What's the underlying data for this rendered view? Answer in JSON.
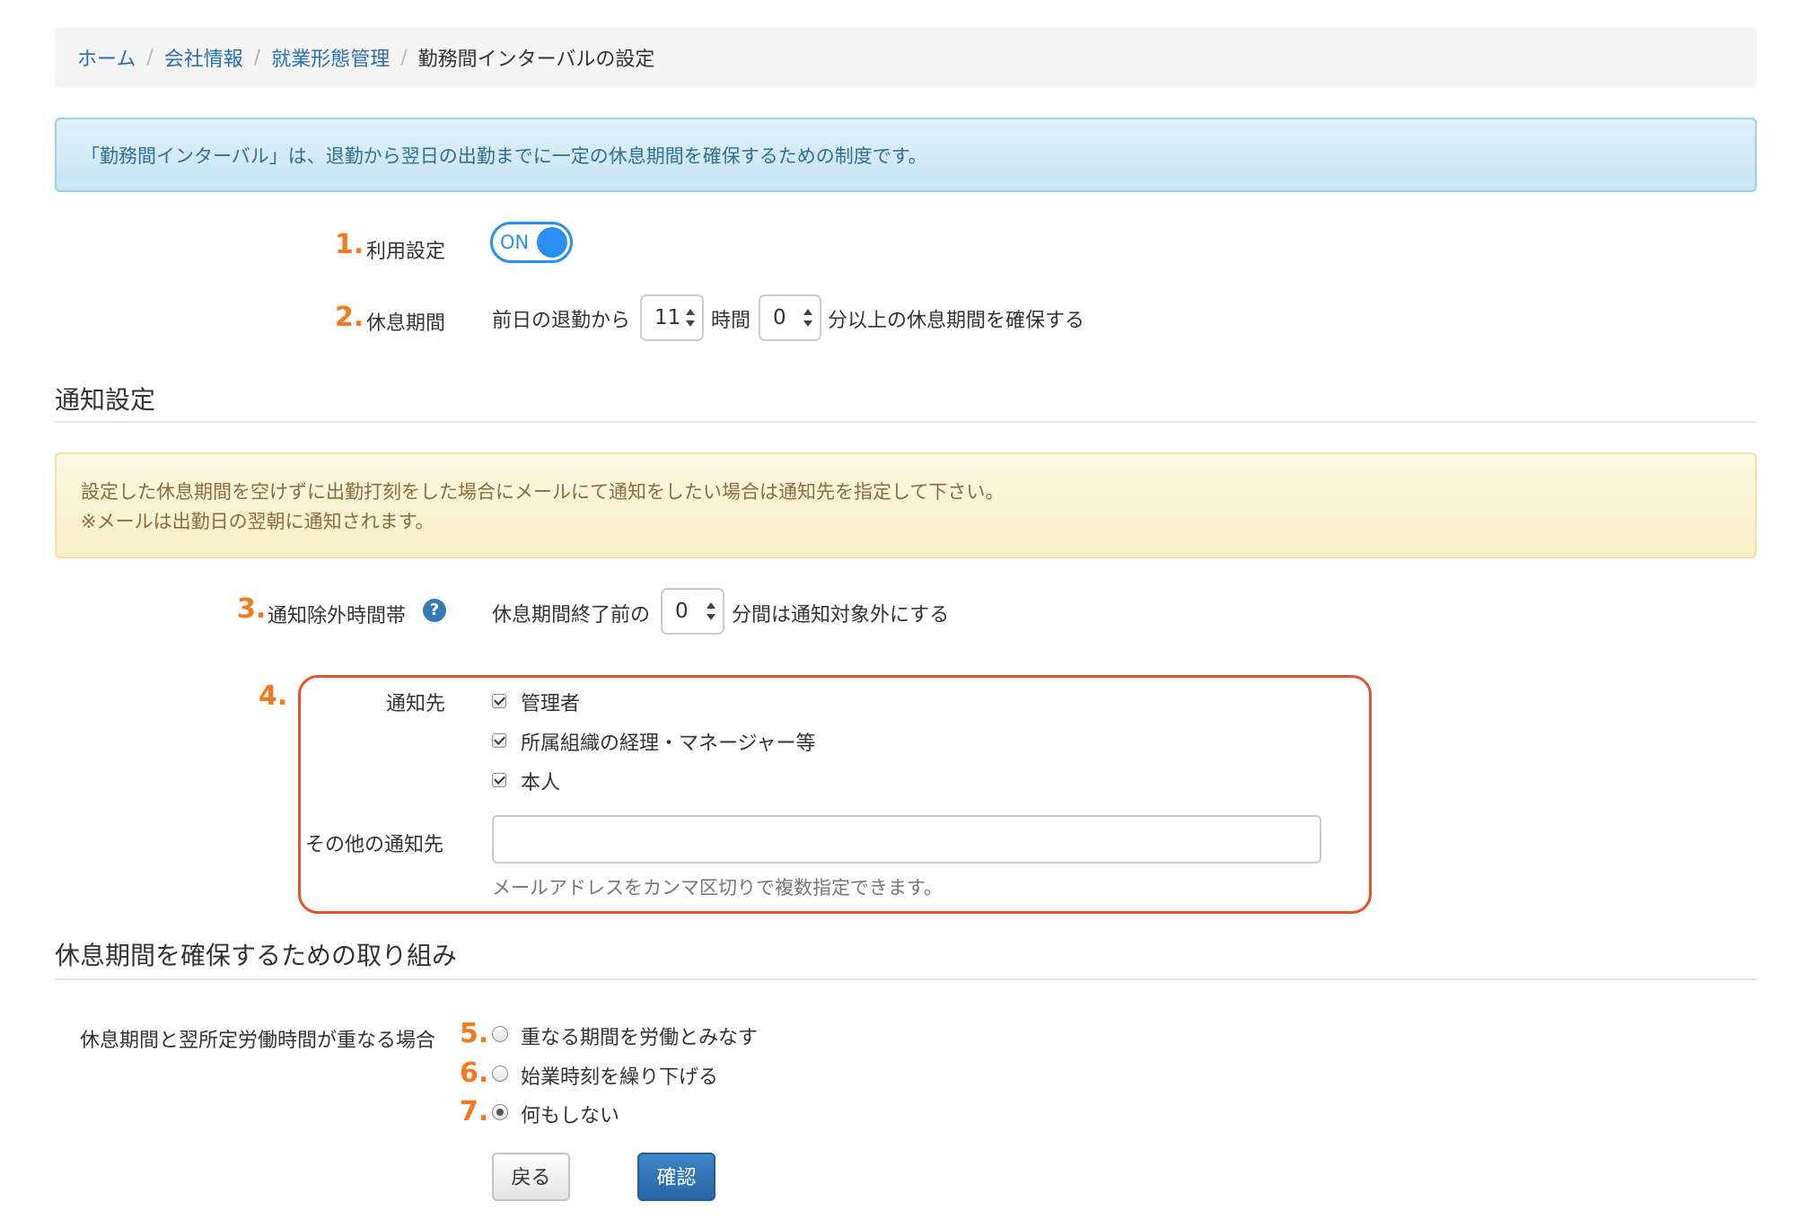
{
  "breadcrumb": {
    "items": [
      "ホーム",
      "会社情報",
      "就業形態管理"
    ],
    "current": "勤務間インターバルの設定",
    "separator": "/"
  },
  "info_alert": "「勤務間インターバル」は、退勤から翌日の出勤までに一定の休息期間を確保するための制度です。",
  "usage": {
    "number": "1.",
    "label": "利用設定",
    "toggle_text": "ON",
    "toggle_on": true
  },
  "rest_period": {
    "number": "2.",
    "label": "休息期間",
    "prefix": "前日の退勤から",
    "hours_value": "11",
    "hours_unit": "時間",
    "minutes_value": "0",
    "suffix": "分以上の休息期間を確保する"
  },
  "notify_section": {
    "title": "通知設定",
    "warning_line1": "設定した休息期間を空けずに出勤打刻をした場合にメールにて通知をしたい場合は通知先を指定して下さい。",
    "warning_line2": "※メールは出勤日の翌朝に通知されます。"
  },
  "exclusion": {
    "number": "3.",
    "label": "通知除外時間帯",
    "help_icon": "?",
    "prefix": "休息期間終了前の",
    "value": "0",
    "suffix": "分間は通知対象外にする"
  },
  "recipients": {
    "number": "4.",
    "label": "通知先",
    "options": [
      {
        "label": "管理者",
        "checked": true
      },
      {
        "label": "所属組織の経理・マネージャー等",
        "checked": true
      },
      {
        "label": "本人",
        "checked": true
      }
    ],
    "other_label": "その他の通知先",
    "other_value": "",
    "other_hint": "メールアドレスをカンマ区切りで複数指定できます。"
  },
  "measures": {
    "title": "休息期間を確保するための取り組み",
    "label": "休息期間と翌所定労働時間が重なる場合",
    "options": [
      {
        "number": "5.",
        "label": "重なる期間を労働とみなす",
        "selected": false
      },
      {
        "number": "6.",
        "label": "始業時刻を繰り下げる",
        "selected": false
      },
      {
        "number": "7.",
        "label": "何もしない",
        "selected": true
      }
    ]
  },
  "buttons": {
    "back": "戻る",
    "confirm": "確認"
  },
  "colors": {
    "accent": "#2a8ff0",
    "number_orange": "#f47a20",
    "highlight_red": "#e5522c",
    "primary_button": "#2865a3"
  }
}
